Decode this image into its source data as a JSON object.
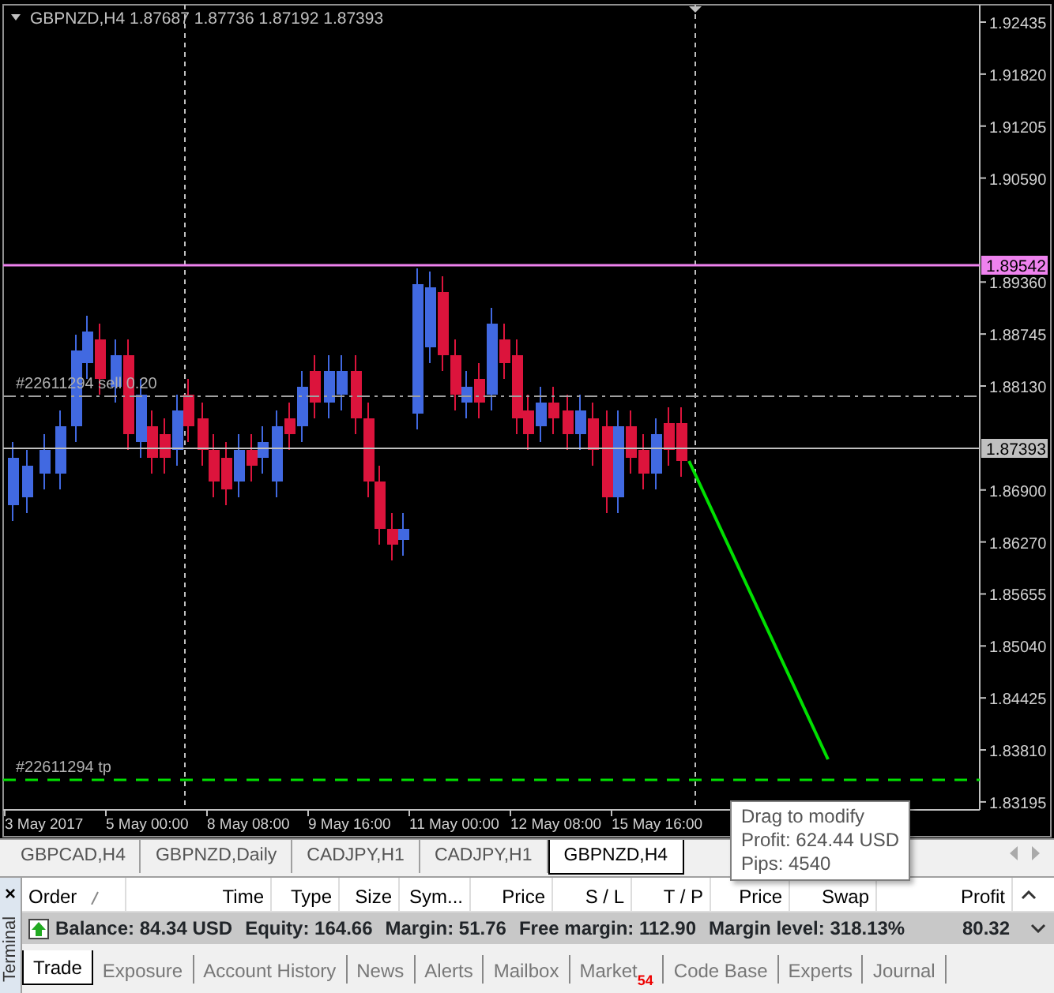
{
  "chart": {
    "symbol": "GBPNZD,H4",
    "ohlc": "1.87687 1.87736 1.87192 1.87393",
    "price_axis": [
      "1.92435",
      "1.91820",
      "1.91205",
      "1.90590",
      "1.89360",
      "1.88745",
      "1.88130",
      "1.86900",
      "1.86270",
      "1.85655",
      "1.85040",
      "1.84425",
      "1.83810",
      "1.83195"
    ],
    "price_marks": [
      {
        "kind": "alert",
        "text": "1.89542"
      },
      {
        "kind": "bid",
        "text": "1.87393"
      }
    ],
    "order_labels": [
      {
        "kind": "order",
        "text": "#22611294 sell 0.20"
      },
      {
        "kind": "tp",
        "text": "#22611294 tp"
      }
    ],
    "time_axis": [
      "3 May 2017",
      "5 May 00:00",
      "8 May 08:00",
      "9 May 16:00",
      "11 May 00:00",
      "12 May 08:00",
      "15 May 16:00"
    ],
    "tooltip": [
      "Drag to modify",
      "Profit: 624.44 USD",
      "Pips: 4540"
    ]
  },
  "chart_tabs": [
    {
      "label": "GBPCAD,H4",
      "selected": false
    },
    {
      "label": "GBPNZD,Daily",
      "selected": false
    },
    {
      "label": "CADJPY,H1",
      "selected": false
    },
    {
      "label": "CADJPY,H1",
      "selected": false
    },
    {
      "label": "GBPNZD,H4",
      "selected": true
    }
  ],
  "terminal": {
    "close": "×",
    "title": "Terminal",
    "columns": [
      "Order",
      "Time",
      "Type",
      "Size",
      "Sym...",
      "Price",
      "S / L",
      "T / P",
      "Price",
      "Swap",
      "Profit"
    ],
    "summary": [
      "Balance: 84.34 USD",
      "Equity: 164.66",
      "Margin: 51.76",
      "Free margin: 112.90",
      "Margin level: 318.13%"
    ],
    "profit": "80.32",
    "tabs": [
      {
        "label": "Trade",
        "selected": true
      },
      {
        "label": "Exposure",
        "selected": false
      },
      {
        "label": "Account History",
        "selected": false
      },
      {
        "label": "News",
        "selected": false
      },
      {
        "label": "Alerts",
        "selected": false
      },
      {
        "label": "Mailbox",
        "selected": false
      },
      {
        "label": "Market",
        "selected": false,
        "badge": "54"
      },
      {
        "label": "Code Base",
        "selected": false
      },
      {
        "label": "Experts",
        "selected": false
      },
      {
        "label": "Journal",
        "selected": false
      }
    ]
  }
}
